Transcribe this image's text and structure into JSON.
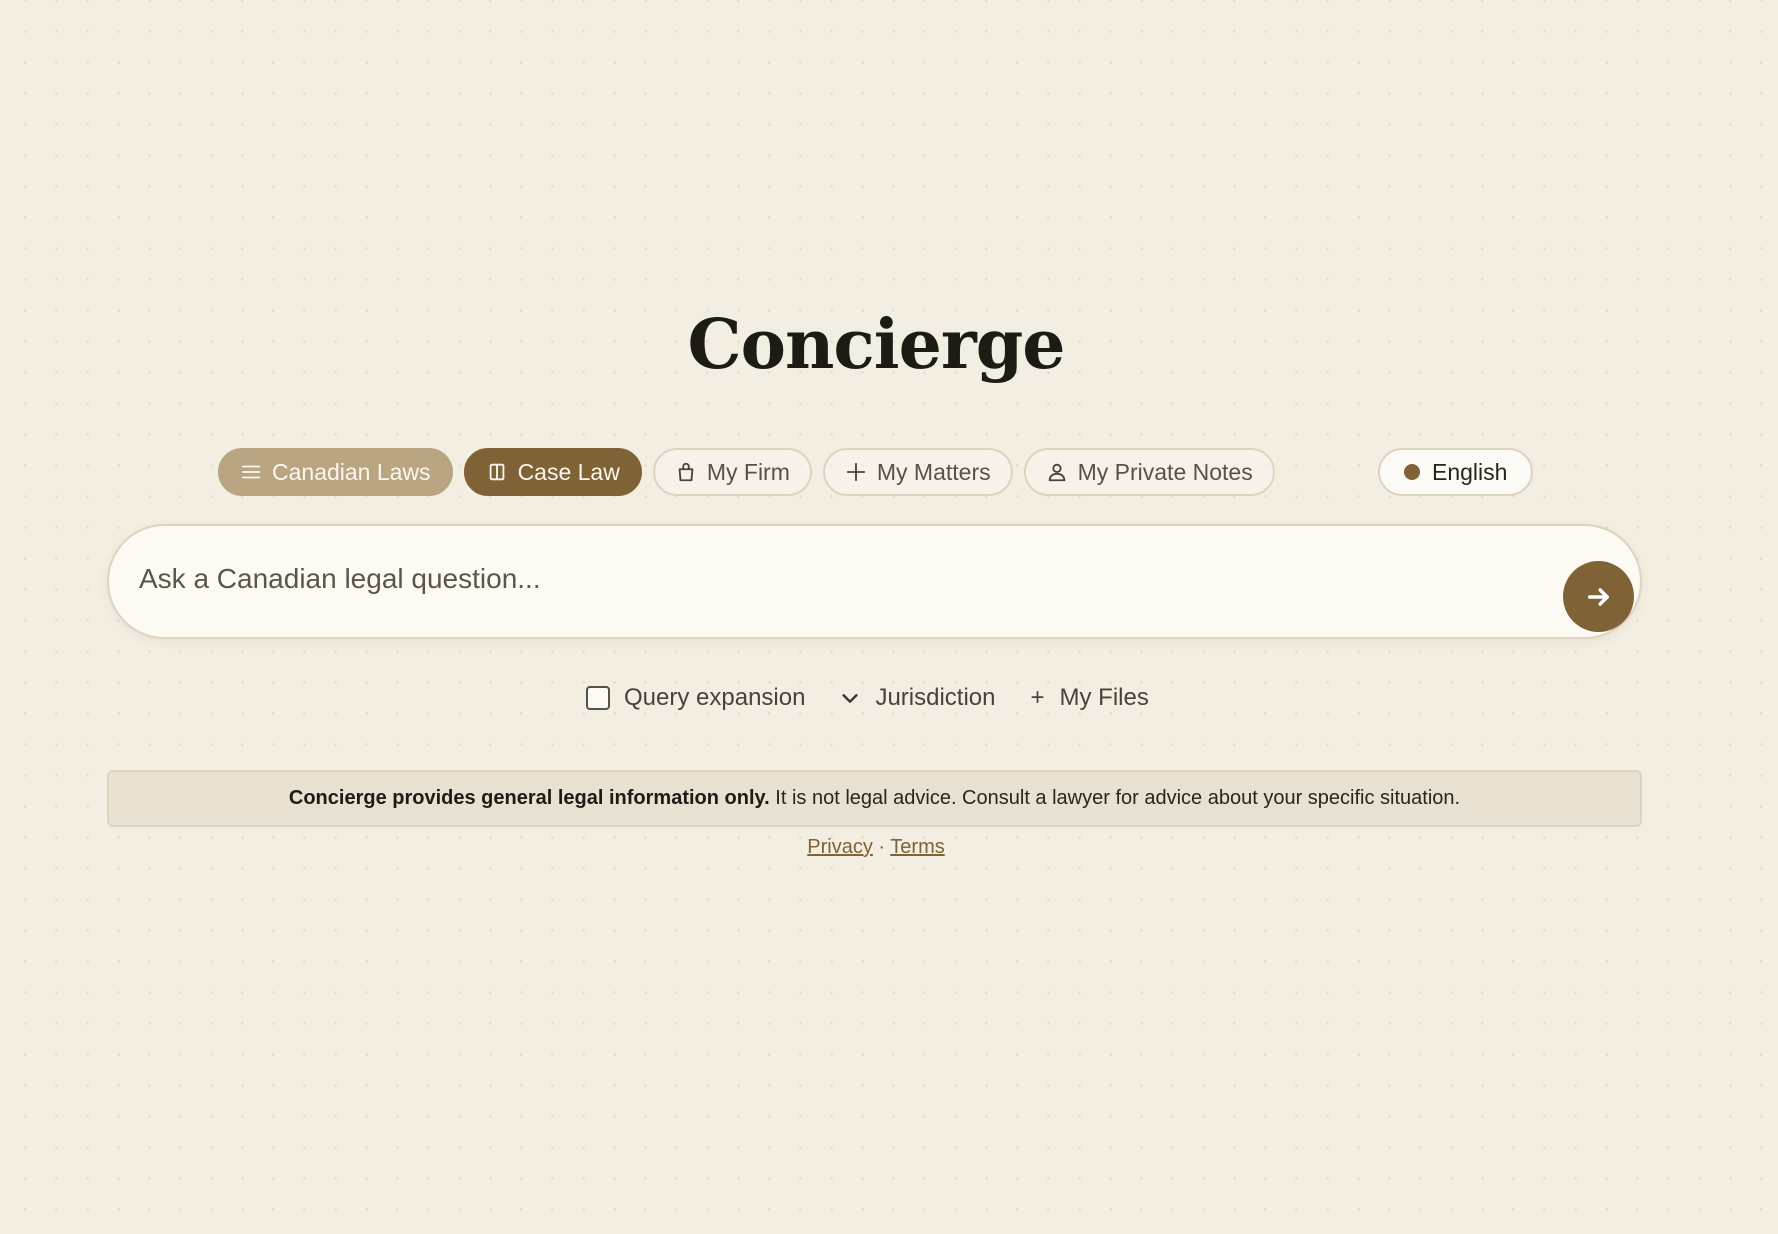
{
  "app": {
    "title": "Concierge"
  },
  "tabs": [
    {
      "label": "Canadian Laws",
      "icon": "menu-lines-icon",
      "state": "selected"
    },
    {
      "label": "Case Law",
      "icon": "book-icon",
      "state": "active"
    },
    {
      "label": "My Firm",
      "icon": "shopping-bag-icon",
      "state": "inactive"
    },
    {
      "label": "My Matters",
      "icon": "plus-icon",
      "state": "inactive"
    },
    {
      "label": "My Private Notes",
      "icon": "user-icon",
      "state": "inactive"
    }
  ],
  "language": {
    "label": "English",
    "icon": "dot-icon"
  },
  "search": {
    "placeholder": "Ask a Canadian legal question...",
    "value": "",
    "submit_icon": "arrow-right-icon"
  },
  "options": {
    "query_expansion": {
      "label": "Query expansion",
      "checked": false
    },
    "jurisdiction": {
      "label": "Jurisdiction",
      "icon": "chevron-down-icon"
    },
    "my_files": {
      "label": "My Files",
      "prefix": "+"
    }
  },
  "disclaimer": {
    "bold": "Concierge provides general legal information only.",
    "text": " It is not legal advice. Consult a lawyer for advice about your specific situation."
  },
  "footer": {
    "privacy": "Privacy",
    "separator": "·",
    "terms": "Terms"
  },
  "colors": {
    "background": "#f3eee2",
    "accent": "#7f6235",
    "selected_tab": "#b9a582",
    "text": "#2a241c"
  }
}
